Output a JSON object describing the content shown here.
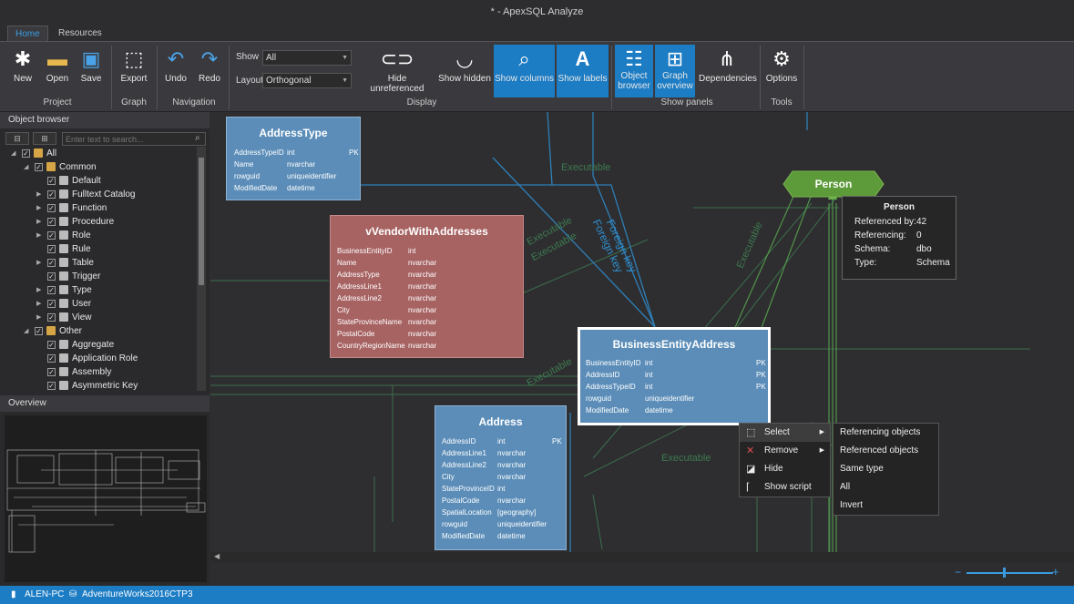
{
  "window": {
    "title": "* - ApexSQL Analyze"
  },
  "tabs": [
    {
      "label": "Home"
    },
    {
      "label": "Resources"
    }
  ],
  "ribbon": {
    "new": "New",
    "open": "Open",
    "save": "Save",
    "export": "Export",
    "undo": "Undo",
    "redo": "Redo",
    "show_label": "Show",
    "show_value": "All",
    "layout_label": "Layout",
    "layout_value": "Orthogonal",
    "hide_unreferenced": "Hide unreferenced",
    "show_hidden": "Show hidden",
    "show_columns": "Show columns",
    "show_labels": "Show labels",
    "object_browser_1": "Object",
    "object_browser_2": "browser",
    "graph_overview_1": "Graph",
    "graph_overview_2": "overview",
    "dependencies": "Dependencies",
    "options": "Options",
    "groups": {
      "project": "Project",
      "graph": "Graph",
      "navigation": "Navigation",
      "display": "Display",
      "show_panels": "Show panels",
      "tools": "Tools"
    },
    "selected_color": "#1c7cc4"
  },
  "object_browser": {
    "title": "Object browser",
    "search_placeholder": "Enter text to search...",
    "items": [
      {
        "label": "All"
      },
      {
        "label": "Common"
      },
      {
        "label": "Default"
      },
      {
        "label": "Fulltext Catalog"
      },
      {
        "label": "Function"
      },
      {
        "label": "Procedure"
      },
      {
        "label": "Role"
      },
      {
        "label": "Rule"
      },
      {
        "label": "Table"
      },
      {
        "label": "Trigger"
      },
      {
        "label": "Type"
      },
      {
        "label": "User"
      },
      {
        "label": "View"
      },
      {
        "label": "Other"
      },
      {
        "label": "Aggregate"
      },
      {
        "label": "Application Role"
      },
      {
        "label": "Assembly"
      },
      {
        "label": "Asymmetric Key"
      }
    ]
  },
  "overview": {
    "title": "Overview"
  },
  "diagram": {
    "edge_labels": [
      "Executable",
      "Executable",
      "Executable",
      "Executable",
      "Executable",
      "Executable",
      "Foreign key",
      "Foreign key"
    ],
    "entities": {
      "address_type": {
        "name": "AddressType",
        "color": "#5b8db8",
        "rows": [
          [
            "AddressTypeID",
            "int",
            "PK"
          ],
          [
            "Name",
            "nvarchar",
            ""
          ],
          [
            "rowguid",
            "uniqueidentifier",
            ""
          ],
          [
            "ModifiedDate",
            "datetime",
            ""
          ]
        ]
      },
      "vendor": {
        "name": "vVendorWithAddresses",
        "color": "#a76262",
        "rows": [
          [
            "BusinessEntityID",
            "int",
            ""
          ],
          [
            "Name",
            "nvarchar",
            ""
          ],
          [
            "AddressType",
            "nvarchar",
            ""
          ],
          [
            "AddressLine1",
            "nvarchar",
            ""
          ],
          [
            "AddressLine2",
            "nvarchar",
            ""
          ],
          [
            "City",
            "nvarchar",
            ""
          ],
          [
            "StateProvinceName",
            "nvarchar",
            ""
          ],
          [
            "PostalCode",
            "nvarchar",
            ""
          ],
          [
            "CountryRegionName",
            "nvarchar",
            ""
          ]
        ]
      },
      "bea": {
        "name": "BusinessEntityAddress",
        "color": "#5b8db8",
        "rows": [
          [
            "BusinessEntityID",
            "int",
            "PK"
          ],
          [
            "AddressID",
            "int",
            "PK"
          ],
          [
            "AddressTypeID",
            "int",
            "PK"
          ],
          [
            "rowguid",
            "uniqueidentifier",
            ""
          ],
          [
            "ModifiedDate",
            "datetime",
            ""
          ]
        ]
      },
      "address": {
        "name": "Address",
        "color": "#5b8db8",
        "rows": [
          [
            "AddressID",
            "int",
            "PK"
          ],
          [
            "AddressLine1",
            "nvarchar",
            ""
          ],
          [
            "AddressLine2",
            "nvarchar",
            ""
          ],
          [
            "City",
            "nvarchar",
            ""
          ],
          [
            "StateProvinceID",
            "int",
            ""
          ],
          [
            "PostalCode",
            "nvarchar",
            ""
          ],
          [
            "SpatialLocation",
            "[geography]",
            ""
          ],
          [
            "rowguid",
            "uniqueidentifier",
            ""
          ],
          [
            "ModifiedDate",
            "datetime",
            ""
          ]
        ]
      }
    },
    "person": {
      "label": "Person",
      "color": "#5c9a3a"
    },
    "tooltip": {
      "title": "Person",
      "rows": [
        [
          "Referenced by:",
          "42"
        ],
        [
          "Referencing:",
          "0"
        ],
        [
          "Schema:",
          "dbo"
        ],
        [
          "Type:",
          "Schema"
        ]
      ]
    }
  },
  "context_menu": {
    "items": [
      {
        "label": "Select",
        "icon": "select-icon"
      },
      {
        "label": "Remove",
        "icon": "remove-icon"
      },
      {
        "label": "Hide",
        "icon": "hide-icon"
      },
      {
        "label": "Show script",
        "icon": "script-icon"
      }
    ],
    "submenu": [
      "Referencing objects",
      "Referenced objects",
      "Same type",
      "All",
      "Invert"
    ]
  },
  "status": {
    "computer": "ALEN-PC",
    "database": "AdventureWorks2016CTP3"
  }
}
